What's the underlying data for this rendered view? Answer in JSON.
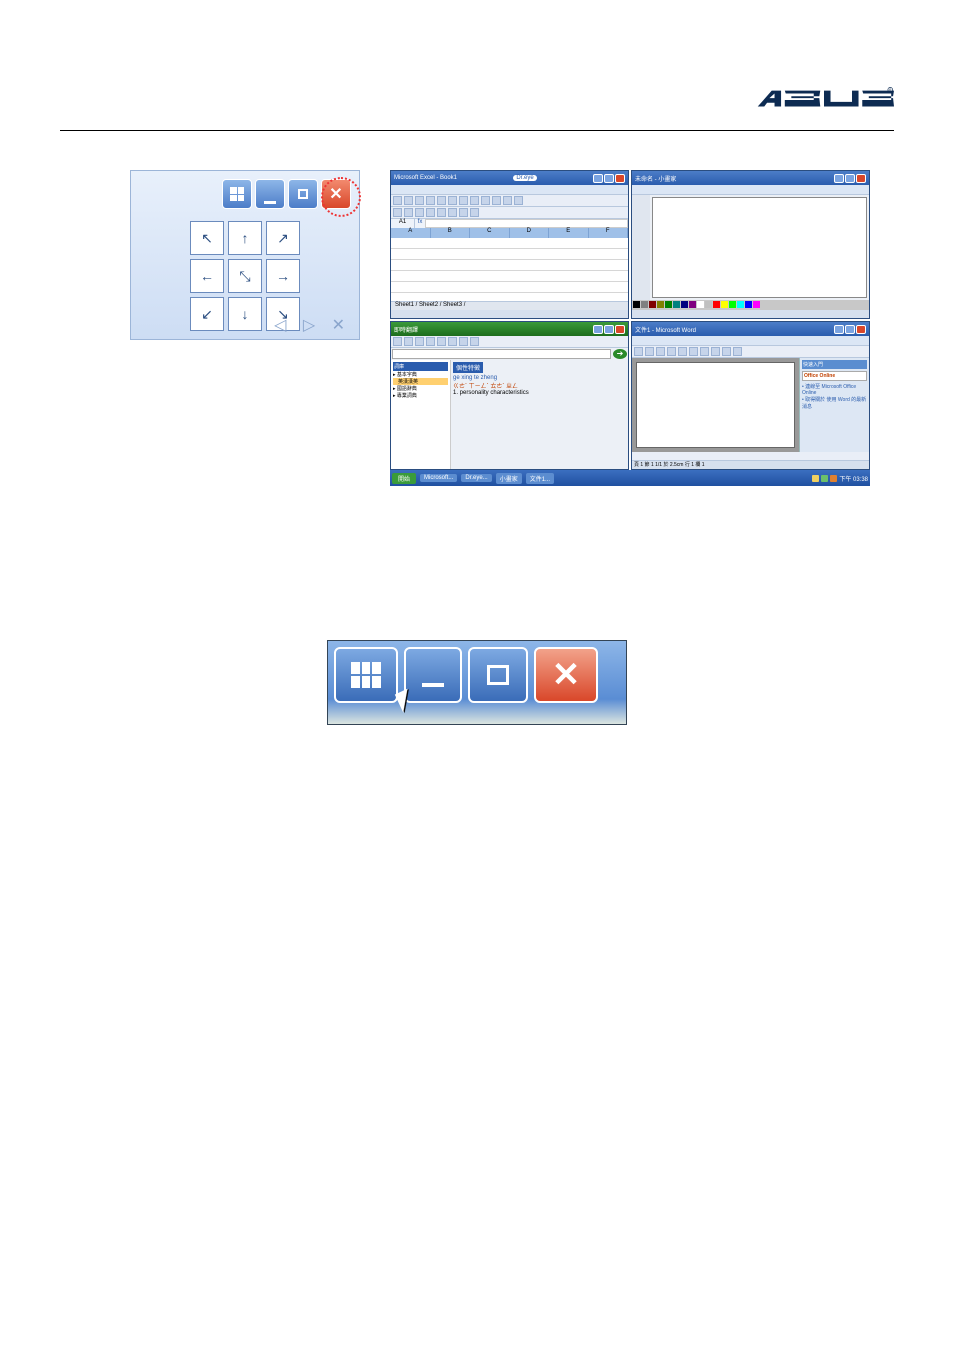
{
  "brand": "ASUS",
  "splitter": {
    "footer_arrows": "◁ ▷ ✕",
    "cells": [
      "↖",
      "↑",
      "↗",
      "←",
      "⤡",
      "→",
      "↙",
      "↓",
      "↘"
    ]
  },
  "windows": {
    "excel": {
      "title": "Microsoft Excel - Book1",
      "badge": "Dr.eye",
      "cell_ref": "A1",
      "columns": [
        "A",
        "B",
        "C",
        "D",
        "E",
        "F"
      ],
      "tabs": "Sheet1 / Sheet2 / Sheet3 /"
    },
    "dict": {
      "title": "即時翻譯",
      "section": "個性特徵",
      "entry_pinyin": "ge xing te zheng",
      "entry_line": "ㄍㄜˋ ㄒㄧㄥˋ ㄊㄜˋ ㄓㄥ",
      "entry_def": "1. personality characteristics"
    },
    "paint": {
      "title": "未命名 - 小畫家",
      "palette": [
        "#000000",
        "#808080",
        "#800000",
        "#808000",
        "#008000",
        "#008080",
        "#000080",
        "#800080",
        "#ffffff",
        "#c0c0c0",
        "#ff0000",
        "#ffff00",
        "#00ff00",
        "#00ffff",
        "#0000ff",
        "#ff00ff"
      ]
    },
    "word": {
      "pane_title": "快速入門",
      "online": "Office Online",
      "links": [
        "連線至 Microsoft Office Online",
        "取得關於 使用 Word 的最新消息"
      ],
      "status": "頁 1    節 1        1/1   於 2.5cm    行 1    欄 1"
    }
  },
  "taskbar": {
    "start": "開始",
    "buttons": [
      "Microsoft...",
      "Dr.eye...",
      "小畫家",
      "文件1..."
    ],
    "time": "下午 03:38"
  },
  "enlarged": {
    "buttons": [
      "grid-button",
      "minimize-button",
      "maximize-button",
      "close-button"
    ]
  }
}
